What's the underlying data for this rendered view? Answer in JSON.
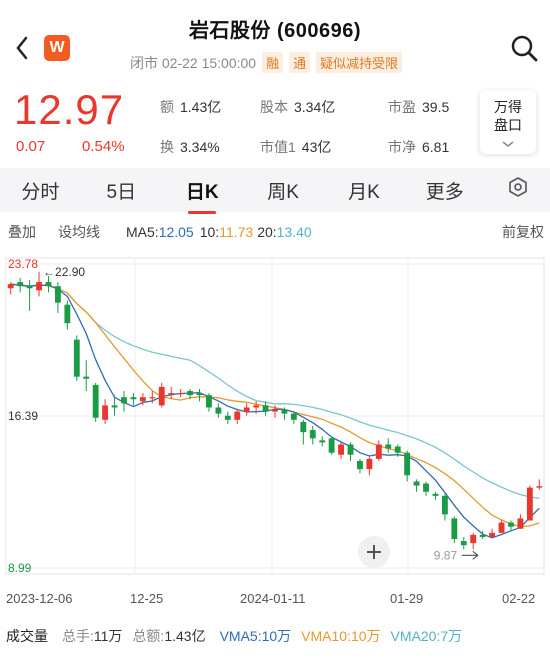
{
  "header": {
    "title": "岩石股份 (600696)",
    "status": "闭市 02-22 15:00:00",
    "tags": [
      "融",
      "通",
      "疑似减持受限"
    ],
    "logo": "W"
  },
  "quote": {
    "price": "12.97",
    "change": "0.07",
    "change_pct": "0.54%",
    "stats": [
      {
        "label": "额",
        "value": "1.43亿"
      },
      {
        "label": "股本",
        "value": "3.34亿"
      },
      {
        "label": "市盈",
        "value": "39.5"
      },
      {
        "label": "换",
        "value": "3.34%"
      },
      {
        "label": "市值1",
        "value": "43亿"
      },
      {
        "label": "市净",
        "value": "6.81"
      }
    ],
    "pankou_line1": "万得",
    "pankou_line2": "盘口",
    "color_up": "#e8372c",
    "color_down": "#1a9b45"
  },
  "tabs": [
    {
      "label": "分时",
      "active": false
    },
    {
      "label": "5日",
      "active": false
    },
    {
      "label": "日K",
      "active": true
    },
    {
      "label": "周K",
      "active": false
    },
    {
      "label": "月K",
      "active": false
    },
    {
      "label": "更多",
      "active": false
    }
  ],
  "toolbar": {
    "overlay": "叠加",
    "ma_setting": "设均线",
    "ma5_label": "MA5:",
    "ma5_value": "12.05",
    "ma10_label": "10:",
    "ma10_value": "11.73",
    "ma20_label": "20:",
    "ma20_value": "13.40",
    "adjust": "前复权"
  },
  "chart_data": {
    "type": "candlestick",
    "ylim": [
      8.99,
      23.78
    ],
    "y_ticks": [
      "23.78",
      "16.39",
      "8.99"
    ],
    "x_ticks": [
      "2023-12-06",
      "12-25",
      "2024-01-11",
      "01-29",
      "02-22"
    ],
    "max_label": "←22.90",
    "min_label": "9.87",
    "colors": {
      "up": "#e8372c",
      "down": "#1a9b45",
      "ma5": "#2f6bb3",
      "ma10": "#e8982c",
      "ma20": "#79c6d0"
    },
    "candles": [
      [
        22.6,
        22.8,
        22.3,
        22.9
      ],
      [
        22.9,
        22.7,
        22.4,
        23.1
      ],
      [
        22.7,
        22.6,
        21.5,
        23.0
      ],
      [
        22.5,
        22.9,
        22.2,
        23.4
      ],
      [
        22.9,
        22.7,
        22.4,
        23.2
      ],
      [
        22.7,
        21.9,
        21.4,
        22.9
      ],
      [
        21.8,
        20.9,
        20.6,
        22.0
      ],
      [
        20.1,
        18.3,
        18.1,
        20.3
      ],
      [
        18.3,
        18.2,
        17.6,
        19.1
      ],
      [
        17.9,
        16.3,
        16.1,
        18.0
      ],
      [
        16.2,
        16.9,
        16.0,
        17.2
      ],
      [
        16.9,
        16.8,
        16.4,
        17.4
      ],
      [
        17.3,
        17.0,
        16.6,
        17.6
      ],
      [
        17.3,
        17.2,
        16.9,
        17.5
      ],
      [
        17.1,
        17.3,
        16.9,
        17.5
      ],
      [
        17.3,
        17.3,
        17.0,
        17.6
      ],
      [
        16.9,
        17.8,
        16.8,
        18.0
      ],
      [
        17.5,
        17.5,
        17.2,
        17.8
      ],
      [
        17.5,
        17.5,
        17.3,
        17.7
      ],
      [
        17.6,
        17.4,
        17.2,
        17.7
      ],
      [
        17.5,
        17.4,
        17.1,
        17.7
      ],
      [
        17.4,
        16.8,
        16.6,
        17.5
      ],
      [
        16.8,
        16.5,
        16.3,
        17.0
      ],
      [
        16.4,
        16.2,
        16.0,
        16.6
      ],
      [
        16.2,
        16.6,
        16.0,
        16.7
      ],
      [
        16.6,
        16.8,
        16.4,
        17.0
      ],
      [
        16.8,
        16.9,
        16.5,
        17.1
      ],
      [
        16.9,
        16.6,
        16.4,
        17.1
      ],
      [
        16.6,
        16.7,
        16.3,
        16.9
      ],
      [
        16.7,
        16.5,
        16.2,
        16.8
      ],
      [
        16.5,
        16.2,
        16.0,
        16.6
      ],
      [
        16.1,
        15.6,
        15.0,
        16.2
      ],
      [
        15.7,
        15.3,
        15.0,
        15.9
      ],
      [
        15.2,
        15.1,
        14.9,
        15.4
      ],
      [
        15.3,
        14.6,
        14.5,
        15.4
      ],
      [
        14.5,
        15.0,
        14.3,
        15.1
      ],
      [
        15.0,
        14.5,
        14.2,
        15.1
      ],
      [
        14.2,
        13.8,
        13.6,
        14.3
      ],
      [
        13.8,
        14.3,
        13.5,
        14.4
      ],
      [
        14.3,
        15.0,
        14.2,
        15.2
      ],
      [
        15.0,
        14.8,
        14.6,
        15.3
      ],
      [
        14.9,
        14.6,
        14.4,
        15.0
      ],
      [
        14.6,
        13.5,
        13.2,
        14.7
      ],
      [
        13.2,
        13.0,
        12.7,
        13.3
      ],
      [
        13.1,
        12.7,
        12.5,
        13.2
      ],
      [
        12.6,
        12.5,
        12.3,
        12.7
      ],
      [
        12.5,
        11.6,
        11.3,
        12.6
      ],
      [
        11.4,
        10.4,
        10.2,
        11.5
      ],
      [
        10.3,
        10.1,
        9.9,
        10.5
      ],
      [
        10.2,
        10.6,
        9.9,
        10.7
      ],
      [
        10.6,
        10.5,
        10.4,
        10.8
      ],
      [
        10.5,
        10.7,
        10.5,
        10.9
      ],
      [
        10.7,
        11.2,
        10.7,
        11.3
      ],
      [
        11.2,
        11.0,
        10.8,
        11.3
      ],
      [
        10.9,
        11.4,
        10.9,
        11.6
      ],
      [
        11.3,
        12.9,
        11.3,
        13.0
      ],
      [
        12.9,
        12.97,
        12.8,
        13.3
      ]
    ]
  },
  "volume_bar": {
    "title": "成交量",
    "total_hands_label": "总手:",
    "total_hands": "11万",
    "total_amount_label": "总额:",
    "total_amount": "1.43亿",
    "vma5": "VMA5:10万",
    "vma10": "VMA10:10万",
    "vma20": "VMA20:7万"
  },
  "icons": {
    "back": "chevron-left-icon",
    "search": "search-icon",
    "settings": "hexagon-gear-icon",
    "add": "plus-icon",
    "expand": "expand-icon",
    "arrow": "arrow-right-icon"
  }
}
